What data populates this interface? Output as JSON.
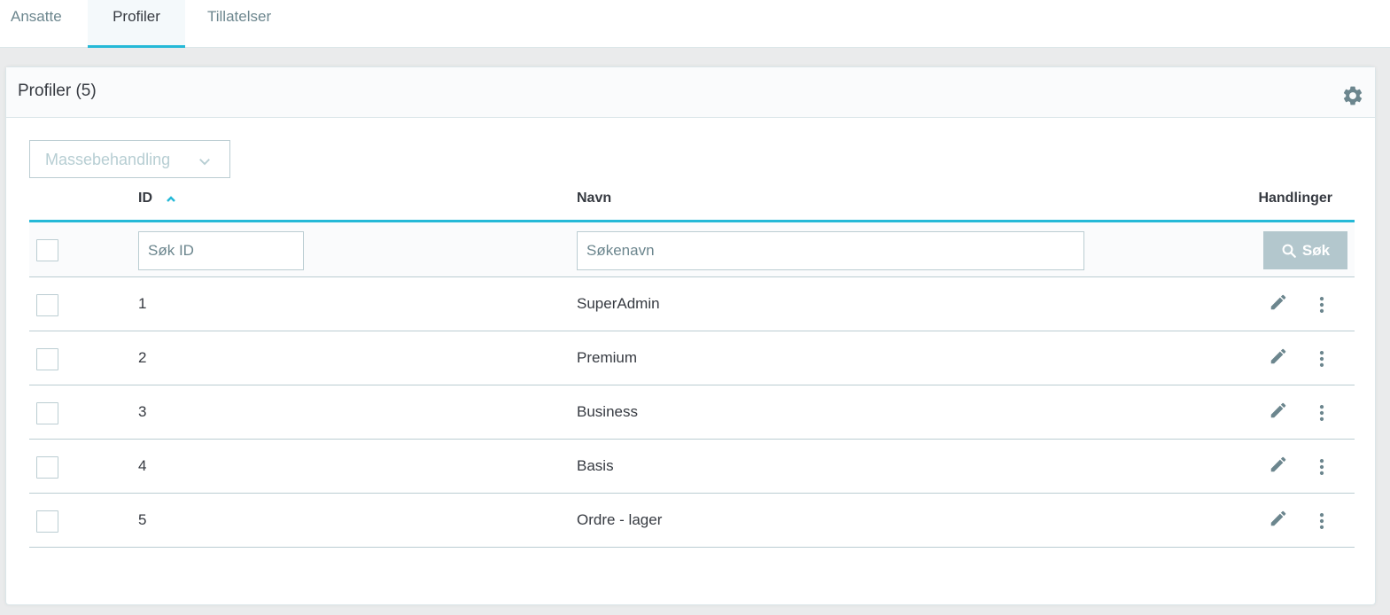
{
  "tabs": [
    {
      "label": "Ansatte"
    },
    {
      "label": "Profiler"
    },
    {
      "label": "Tillatelser"
    }
  ],
  "card": {
    "title": "Profiler (5)"
  },
  "bulk": {
    "label": "Massebehandling"
  },
  "table": {
    "headers": {
      "id": "ID",
      "name": "Navn",
      "actions": "Handlinger"
    },
    "filters": {
      "id_placeholder": "Søk ID",
      "name_placeholder": "Søkenavn",
      "search_label": "Søk"
    },
    "rows": [
      {
        "id": "1",
        "name": "SuperAdmin"
      },
      {
        "id": "2",
        "name": "Premium"
      },
      {
        "id": "3",
        "name": "Business"
      },
      {
        "id": "4",
        "name": "Basis"
      },
      {
        "id": "5",
        "name": "Ordre - lager"
      }
    ]
  },
  "colors": {
    "accent": "#25b9d7",
    "icon": "#6c868e",
    "search_button": "#b3c7cd"
  },
  "icons": {
    "settings": "gear-icon",
    "sort": "chevron-up-icon",
    "search": "search-icon",
    "edit": "pencil-icon",
    "more": "more-vertical-icon",
    "dropdown": "chevron-down-icon"
  }
}
